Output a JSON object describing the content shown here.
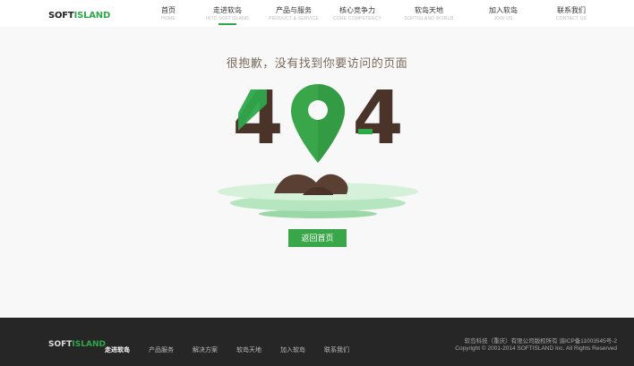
{
  "header": {
    "logo_part1": "SOFT",
    "logo_part2": "ISLAND",
    "nav": [
      {
        "zh": "首页",
        "en": "HOME"
      },
      {
        "zh": "走进软岛",
        "en": "INTO SOFTISLAND"
      },
      {
        "zh": "产品与服务",
        "en": "PRODUCT & SERVICE"
      },
      {
        "zh": "核心竞争力",
        "en": "CORE COMPETENCY"
      },
      {
        "zh": "软岛天地",
        "en": "SOFTISLAND WORLD"
      },
      {
        "zh": "加入软岛",
        "en": "JOIN US"
      },
      {
        "zh": "联系我们",
        "en": "CONTACT US"
      }
    ]
  },
  "main": {
    "headline": "很抱歉，没有找到你要访问的页面",
    "digit_left": "4",
    "digit_right": "4",
    "back_button": "返回首页"
  },
  "footer": {
    "logo_part1": "SOFT",
    "logo_part2": "ISLAND",
    "nav": [
      "走进软岛",
      "产品服务",
      "解决方案",
      "软岛天地",
      "加入软岛",
      "联系我们"
    ],
    "copyright_line1": "软岛科技（重庆）有限公司版权所有  渝ICP备11003545号-2",
    "copyright_line2": "Copyright © 2001-2014 SOFTISLAND Inc. All Rights Reserved"
  },
  "colors": {
    "accent": "#3aa64a",
    "digit_brown": "#4a3328",
    "footer_bg": "#262626"
  }
}
